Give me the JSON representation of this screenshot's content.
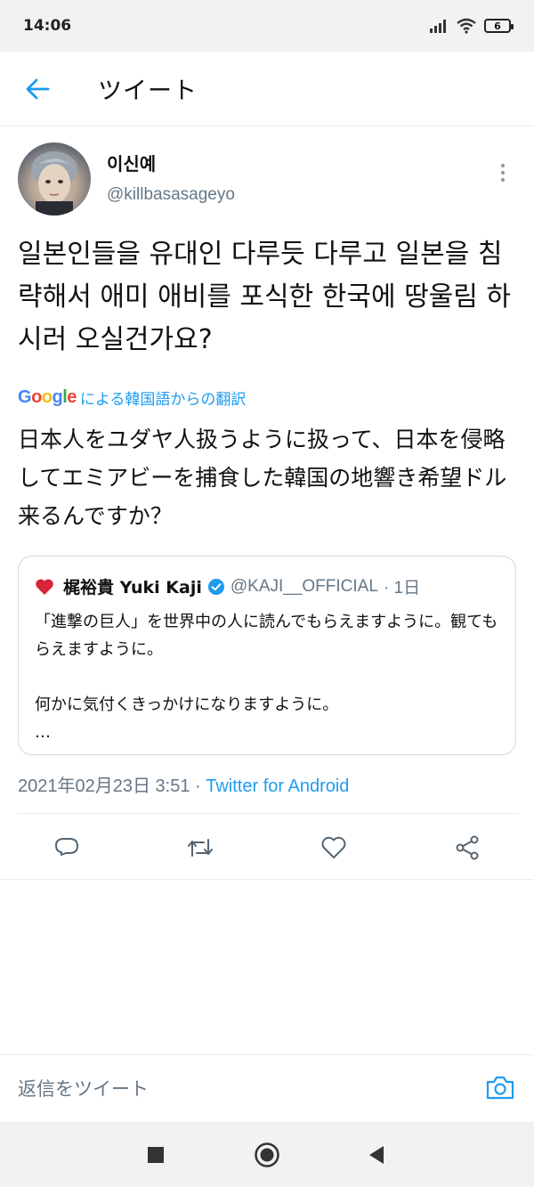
{
  "status_bar": {
    "time": "14:06",
    "battery": "6"
  },
  "header": {
    "title": "ツイート"
  },
  "tweet": {
    "author_name": "이신예",
    "author_handle": "@killbasasageyo",
    "text": "일본인들을 유대인 다루듯 다루고 일본을 침략해서 애미 애비를 포식한 한국에 땅울림 하시러 오실건가요?",
    "translation_label": "による韓国語からの翻訳",
    "google_logo": "Google",
    "translated_text": "日本人をユダヤ人扱うように扱って、日本を侵略してエミアビーを捕食した韓国の地響き希望ドル来るんですか？",
    "quote": {
      "name": "梶裕貴 Yuki Kaji",
      "handle": "@KAJI__OFFICIAL",
      "age": "· 1日",
      "text": "「進撃の巨人」を世界中の人に読んでもらえますように。観てもらえますように。\n\n何かに気付くきっかけになりますように。\n…"
    },
    "timestamp": "2021年02月23日 3:51 ·",
    "source": "Twitter for Android"
  },
  "reply": {
    "placeholder": "返信をツイート"
  },
  "colors": {
    "accent": "#1d9bf0",
    "secondary_text": "#657786",
    "heart": "#e0245e"
  }
}
